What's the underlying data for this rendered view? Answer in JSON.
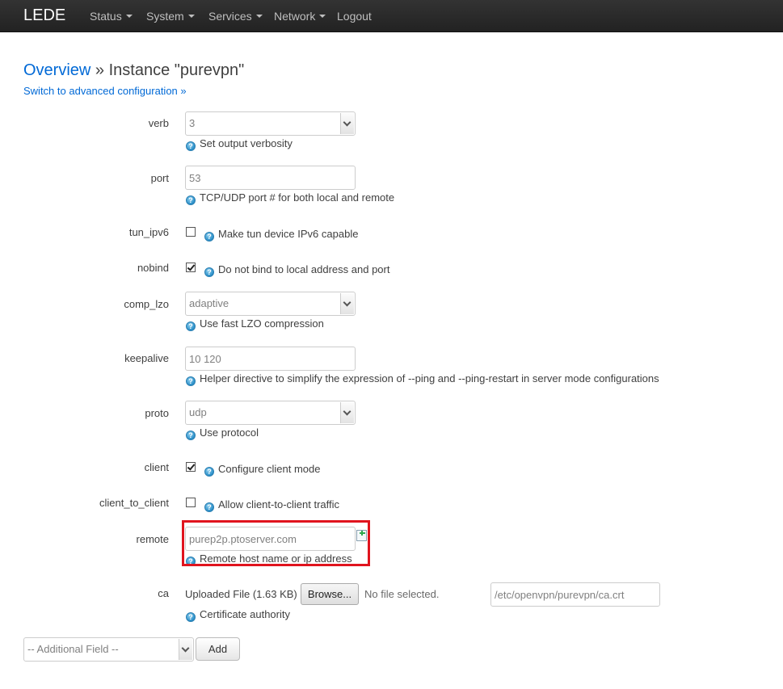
{
  "navbar": {
    "brand": "LEDE",
    "items": [
      {
        "label": "Status",
        "has_caret": true
      },
      {
        "label": "System",
        "has_caret": true
      },
      {
        "label": "Services",
        "has_caret": true
      },
      {
        "label": "Network",
        "has_caret": true
      },
      {
        "label": "Logout",
        "has_caret": false
      }
    ]
  },
  "page": {
    "breadcrumb_link": "Overview",
    "breadcrumb_sep": " » ",
    "title": "Instance \"purevpn\"",
    "advanced_link": "Switch to advanced configuration »"
  },
  "fields": {
    "verb": {
      "label": "verb",
      "value": "3",
      "help": "Set output verbosity"
    },
    "port": {
      "label": "port",
      "value": "53",
      "help": "TCP/UDP port # for both local and remote"
    },
    "tun_ipv6": {
      "label": "tun_ipv6",
      "checked": false,
      "help": "Make tun device IPv6 capable"
    },
    "nobind": {
      "label": "nobind",
      "checked": true,
      "help": "Do not bind to local address and port"
    },
    "comp_lzo": {
      "label": "comp_lzo",
      "value": "adaptive",
      "help": "Use fast LZO compression"
    },
    "keepalive": {
      "label": "keepalive",
      "value": "10 120",
      "help": "Helper directive to simplify the expression of --ping and --ping-restart in server mode configurations"
    },
    "proto": {
      "label": "proto",
      "value": "udp",
      "help": "Use protocol"
    },
    "client": {
      "label": "client",
      "checked": true,
      "help": "Configure client mode"
    },
    "client_to_client": {
      "label": "client_to_client",
      "checked": false,
      "help": "Allow client-to-client traffic"
    },
    "remote": {
      "label": "remote",
      "value": "purep2p.ptoserver.com",
      "help": "Remote host name or ip address"
    },
    "ca": {
      "label": "ca",
      "uploaded": "Uploaded File (1.63 KB)",
      "browse_label": "Browse...",
      "no_file": "No file selected.",
      "path": "/etc/openvpn/purevpn/ca.crt",
      "help": "Certificate authority"
    }
  },
  "footer": {
    "additional_field": "-- Additional Field --",
    "add_label": "Add"
  },
  "icons": {
    "help": "help-icon",
    "add": "add-entry-icon"
  },
  "colors": {
    "link": "#0069d6",
    "highlight": "#e0141e",
    "navbar": "#222222"
  }
}
